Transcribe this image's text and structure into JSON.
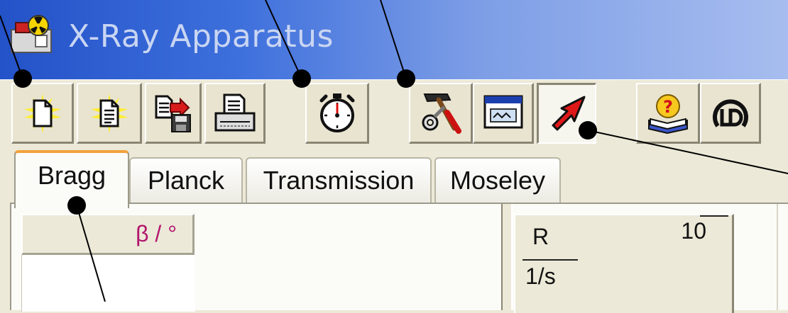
{
  "window": {
    "title": "X-Ray Apparatus"
  },
  "toolbar": {
    "buttons": [
      {
        "icon": "new-file-icon"
      },
      {
        "icon": "new-document-icon"
      },
      {
        "icon": "save-icon"
      },
      {
        "icon": "print-icon"
      },
      {
        "icon": "stopwatch-icon"
      },
      {
        "icon": "tools-icon"
      },
      {
        "icon": "display-window-icon"
      },
      {
        "icon": "red-arrow-pointer-icon"
      },
      {
        "icon": "help-book-icon"
      },
      {
        "icon": "ld-logo-icon"
      }
    ]
  },
  "tabs": [
    {
      "label": "Bragg",
      "active": true
    },
    {
      "label": "Planck",
      "active": false
    },
    {
      "label": "Transmission",
      "active": false
    },
    {
      "label": "Moseley",
      "active": false
    }
  ],
  "table": {
    "column_header": "β / °"
  },
  "rate_display": {
    "label": "R",
    "value": "10",
    "unit": "1/s"
  },
  "colors": {
    "title_gradient_start": "#2452c8",
    "title_gradient_end": "#a7bdef",
    "active_tab_accent": "#f2a23c",
    "beta_header_text": "#b2156e"
  }
}
